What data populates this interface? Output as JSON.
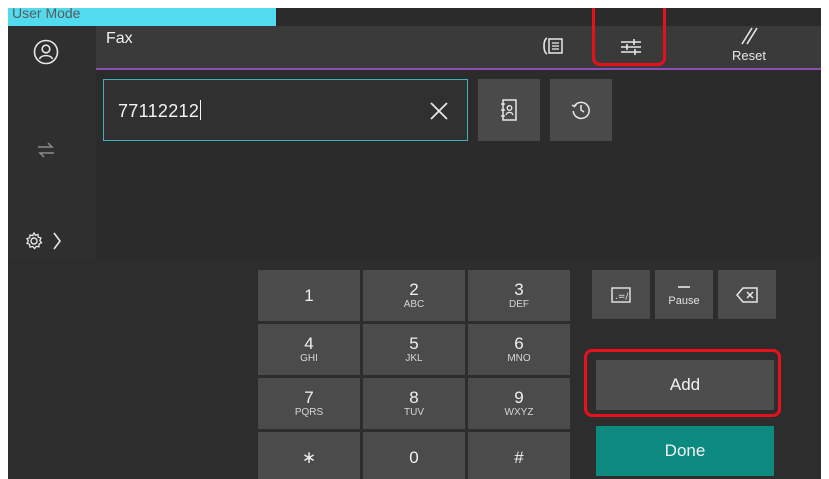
{
  "status": {
    "mode_label": "User Mode"
  },
  "header": {
    "title": "Fax",
    "reset_label": "Reset"
  },
  "icons": {
    "user": "user-icon",
    "switch": "swap-icon",
    "settings": "gear-icon",
    "expand": "chevron-right-icon",
    "fax_status": "fax-phone-icon",
    "options": "sliders-icon",
    "reset": "double-slash-icon",
    "clear": "close-icon",
    "address_book": "address-book-icon",
    "history": "history-icon",
    "pause": "dash-icon",
    "backspace": "backspace-icon",
    "tone": "tone-icon"
  },
  "fax_input": {
    "value": "77112212"
  },
  "keypad": {
    "keys": [
      {
        "num": "1",
        "sub": ""
      },
      {
        "num": "2",
        "sub": "ABC"
      },
      {
        "num": "3",
        "sub": "DEF"
      },
      {
        "num": "4",
        "sub": "GHI"
      },
      {
        "num": "5",
        "sub": "JKL"
      },
      {
        "num": "6",
        "sub": "MNO"
      },
      {
        "num": "7",
        "sub": "PQRS"
      },
      {
        "num": "8",
        "sub": "TUV"
      },
      {
        "num": "9",
        "sub": "WXYZ"
      },
      {
        "num": "∗",
        "sub": ""
      },
      {
        "num": "0",
        "sub": ""
      },
      {
        "num": "#",
        "sub": ""
      }
    ]
  },
  "functions": {
    "pause_label": "Pause"
  },
  "actions": {
    "add_label": "Add",
    "done_label": "Done"
  },
  "colors": {
    "accent_cyan": "#52dbee",
    "input_border": "#3fb0b8",
    "done_green": "#0d8a80",
    "highlight_red": "#e8101c",
    "header_line": "#8a4fb5"
  }
}
